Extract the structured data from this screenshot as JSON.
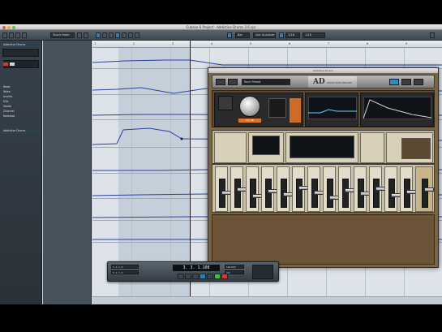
{
  "window": {
    "title": "Cubase 6 Project - Addictive Drums 2.6.cpr"
  },
  "toolbar": {
    "mode_label": "Touch Fader",
    "grid_label": "Bar",
    "quantize_label": "1/16",
    "snap_label": "Use Quantize",
    "zoom_label": "1/16"
  },
  "inspector": {
    "track_name": "Addictive Drums",
    "rows": [
      "Addictive Drums",
      "Read",
      "Write",
      "Inserts",
      "EQs",
      "Sends",
      "Channel",
      "Notepad"
    ],
    "section_label": "Addictive Drums"
  },
  "tracks": [
    {
      "name": "Kick"
    },
    {
      "name": "Snare"
    },
    {
      "name": "HiHat"
    },
    {
      "name": "Toms"
    },
    {
      "name": "Overheads"
    },
    {
      "name": "Room"
    },
    {
      "name": "Bus"
    },
    {
      "name": "Master"
    }
  ],
  "ruler": {
    "marks": [
      "1",
      "2",
      "3",
      "4",
      "5",
      "6",
      "7",
      "8",
      "9"
    ]
  },
  "plugin": {
    "title": "Addictive Drums",
    "preset_name": "Rock Preset",
    "logo_text": "AD",
    "logo_sub": "ADDICTIVE DRUMS",
    "knob_value": "0.0 dB"
  },
  "transport": {
    "time": "3. 3. 1.108",
    "left_locator": "1. 1. 1. 0",
    "right_locator": "5. 1. 1. 0",
    "tempo": "120.000",
    "signature": "4/4"
  },
  "colors": {
    "accent": "#2f7fb0",
    "meter": "#62c64a",
    "plugin_wood": "#7a6446"
  }
}
